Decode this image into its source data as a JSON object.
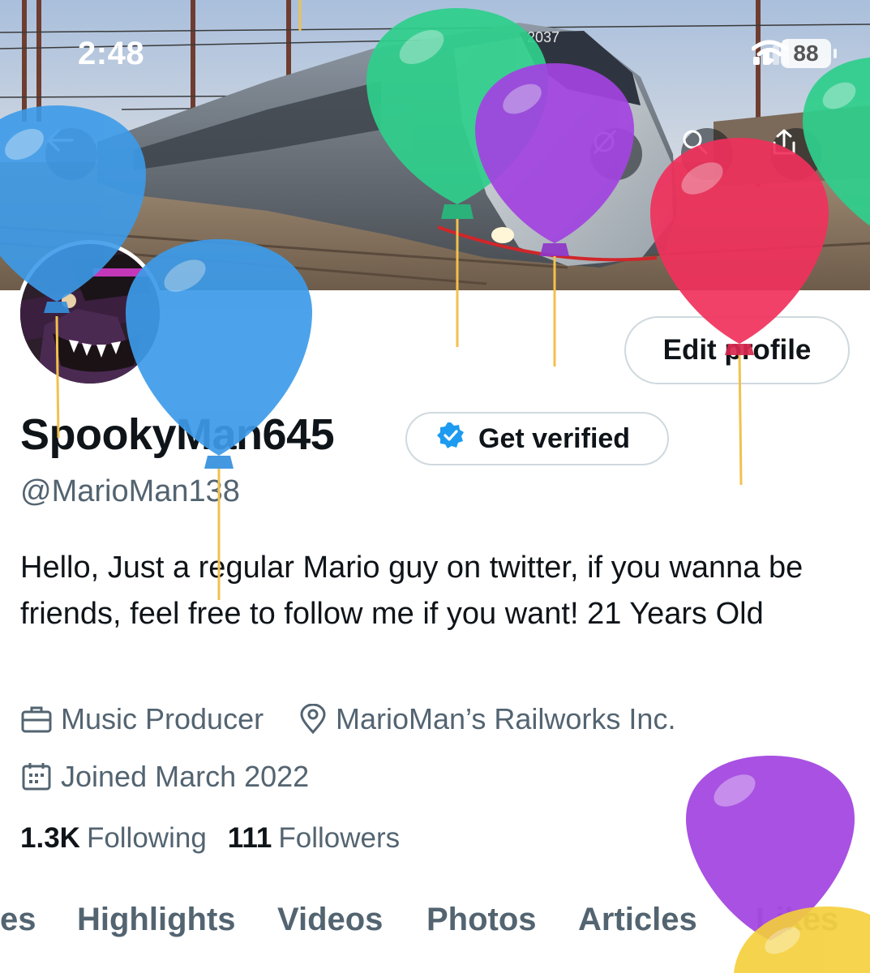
{
  "status_bar": {
    "time": "2:48",
    "battery": "88",
    "icons": [
      "cellular-signal-icon",
      "wifi-icon",
      "battery-icon"
    ]
  },
  "banner": {
    "train_number": "2037",
    "buttons": [
      "back-arrow-icon",
      "grok-icon",
      "search-icon",
      "share-icon"
    ]
  },
  "profile": {
    "edit_label": "Edit profile",
    "display_name": "SpookyMan645",
    "get_verified_label": "Get verified",
    "handle": "@MarioMan138",
    "bio": "Hello, Just a regular Mario guy on twitter, if you wanna be friends, feel free to follow me if you want! 21 Years Old",
    "profession": "Music Producer",
    "location": "MarioMan’s Railworks Inc.",
    "joined": "Joined March 2022",
    "following_count": "1.3K",
    "following_label": "Following",
    "followers_count": "111",
    "followers_label": "Followers"
  },
  "tabs": [
    "es",
    "Highlights",
    "Videos",
    "Photos",
    "Articles",
    "Likes"
  ],
  "colors": {
    "text_primary": "#0f1419",
    "text_secondary": "#536471",
    "border": "#cfd9de",
    "verified_blue": "#1d9bf0",
    "balloon_blue": "#3d9be9",
    "balloon_green": "#2fcf8c",
    "balloon_purple": "#a244e0",
    "balloon_red": "#f0315c",
    "balloon_yellow": "#f5cf3a"
  }
}
